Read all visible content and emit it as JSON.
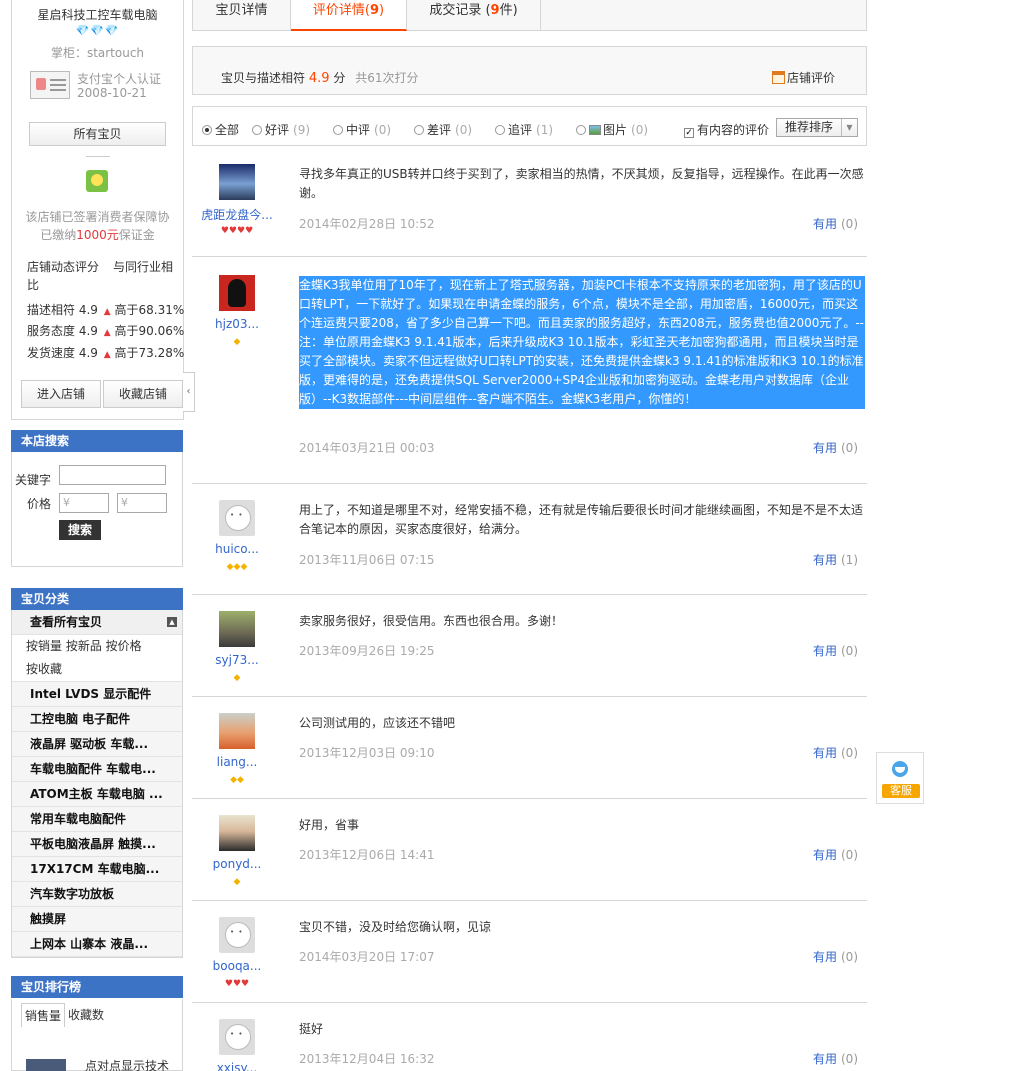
{
  "shop": {
    "name": "星启科技工控车载电脑",
    "rank": "💎💎💎",
    "keeper": "掌柜：startouch",
    "cert": "支付宝个人认证",
    "cert_date": "2008-10-21",
    "all_items_btn": "所有宝贝",
    "protect_line1": "该店铺已签署消费者保障协",
    "protect_pre": "已缴纳",
    "protect_money": "1000元",
    "protect_post": "保证金",
    "dsr_header1": "店铺动态评分",
    "dsr_header2": "与同行业相比",
    "dsr": [
      {
        "label": "描述相符",
        "score": "4.9",
        "compare": "高于68.31%"
      },
      {
        "label": "服务态度",
        "score": "4.9",
        "compare": "高于90.06%"
      },
      {
        "label": "发货速度",
        "score": "4.9",
        "compare": "高于73.28%"
      }
    ],
    "enter_btn": "进入店铺",
    "fav_btn": "收藏店铺",
    "collapse": "‹"
  },
  "search": {
    "title": "本店搜索",
    "keyword_label": "关键字",
    "price_label": "价格",
    "price_min_placeholder": "¥",
    "price_max_placeholder": "¥",
    "button": "搜索"
  },
  "categories": {
    "title": "宝贝分类",
    "view_all": "查看所有宝贝",
    "toggle": "▲",
    "sort_line1": "按销量 按新品 按价格",
    "sort_line2": "按收藏",
    "items": [
      "Intel LVDS 显示配件",
      "工控电脑 电子配件",
      "液晶屏 驱动板 车载...",
      "车载电脑配件 车载电...",
      "ATOM主板 车载电脑 ...",
      "常用车载电脑配件",
      "平板电脑液晶屏 触摸...",
      "17X17CM 车载电脑...",
      "汽车数字功放板",
      "触摸屏",
      "上网本 山寨本 液晶..."
    ]
  },
  "ranking": {
    "title": "宝贝排行榜",
    "tab_sales": "销售量",
    "tab_fav": "收藏数",
    "first_item": "点对点显示技术"
  },
  "tabs": {
    "detail": "宝贝详情",
    "reviews_label": "评价详情(",
    "reviews_count": "9",
    "reviews_close": ")",
    "records_label": "成交记录 (",
    "records_count": "9",
    "records_close": "件)"
  },
  "summary": {
    "label": "宝贝与描述相符",
    "score": "4.9",
    "unit": "分",
    "count": "共61次打分",
    "store_link": "店铺评价"
  },
  "filters": {
    "all": "全部",
    "good": "好评",
    "good_count": "(9)",
    "mid": "中评",
    "mid_count": "(0)",
    "bad": "差评",
    "bad_count": "(0)",
    "append": "追评",
    "append_count": "(1)",
    "pics": "图片",
    "pics_count": "(0)",
    "has_content": "有内容的评价",
    "sort": "推荐排序"
  },
  "useful_label": "有用",
  "reviews": [
    {
      "user": "虎距龙盘今...",
      "rank": "♥♥♥♥",
      "text": "寻找多年真正的USB转并口终于买到了，卖家相当的热情，不厌其烦，反复指导，远程操作。在此再一次感谢。",
      "date": "2014年02月28日 10:52",
      "useful": "(0)"
    },
    {
      "user": "hjz03...",
      "rank": "◆",
      "text": "金蝶K3我单位用了10年了，现在新上了塔式服务器，加装PCI卡根本不支持原来的老加密狗，用了该店的U口转LPT，一下就好了。如果现在申请金蝶的服务，6个点，模块不是全部，用加密盾，16000元，而买这个连运费只要208，省了多少自己算一下吧。而且卖家的服务超好，东西208元，服务费也值2000元了。--注：单位原用金蝶K3 9.1.41版本，后来升级成K3 10.1版本，彩虹圣天老加密狗都通用，而且模块当时是买了全部模块。卖家不但远程做好U口转LPT的安装，还免费提供金蝶k3 9.1.41的标准版和K3 10.1的标准版，更难得的是，还免费提供SQL Server2000+SP4企业版和加密狗驱动。金蝶老用户对数据库（企业版）--K3数据部件---中间层组件--客户端不陌生。金蝶K3老用户，你懂的！",
      "date": "2014年03月21日 00:03",
      "useful": "(0)"
    },
    {
      "user": "huico...",
      "rank": "◆◆◆",
      "text": "用上了，不知道是哪里不对，经常安插不稳，还有就是传输后要很长时间才能继续画图，不知是不是不太适合笔记本的原因，买家态度很好，给满分。",
      "date": "2013年11月06日 07:15",
      "useful": "(1)"
    },
    {
      "user": "syj73...",
      "rank": "◆",
      "text": "卖家服务很好，很受信用。东西也很合用。多谢！",
      "date": "2013年09月26日 19:25",
      "useful": "(0)"
    },
    {
      "user": "liang...",
      "rank": "◆◆",
      "text": "公司测试用的，应该还不错吧",
      "date": "2013年12月03日 09:10",
      "useful": "(0)"
    },
    {
      "user": "ponyd...",
      "rank": "◆",
      "text": "好用，省事",
      "date": "2013年12月06日 14:41",
      "useful": "(0)"
    },
    {
      "user": "booqa...",
      "rank": "♥♥♥",
      "text": "宝贝不错，没及时给您确认啊，见谅",
      "date": "2014年03月20日 17:07",
      "useful": "(0)"
    },
    {
      "user": "xxisy...",
      "rank": "",
      "text": "挺好",
      "date": "2013年12月04日 16:32",
      "useful": "(0)"
    }
  ],
  "service": {
    "label": "客服"
  }
}
